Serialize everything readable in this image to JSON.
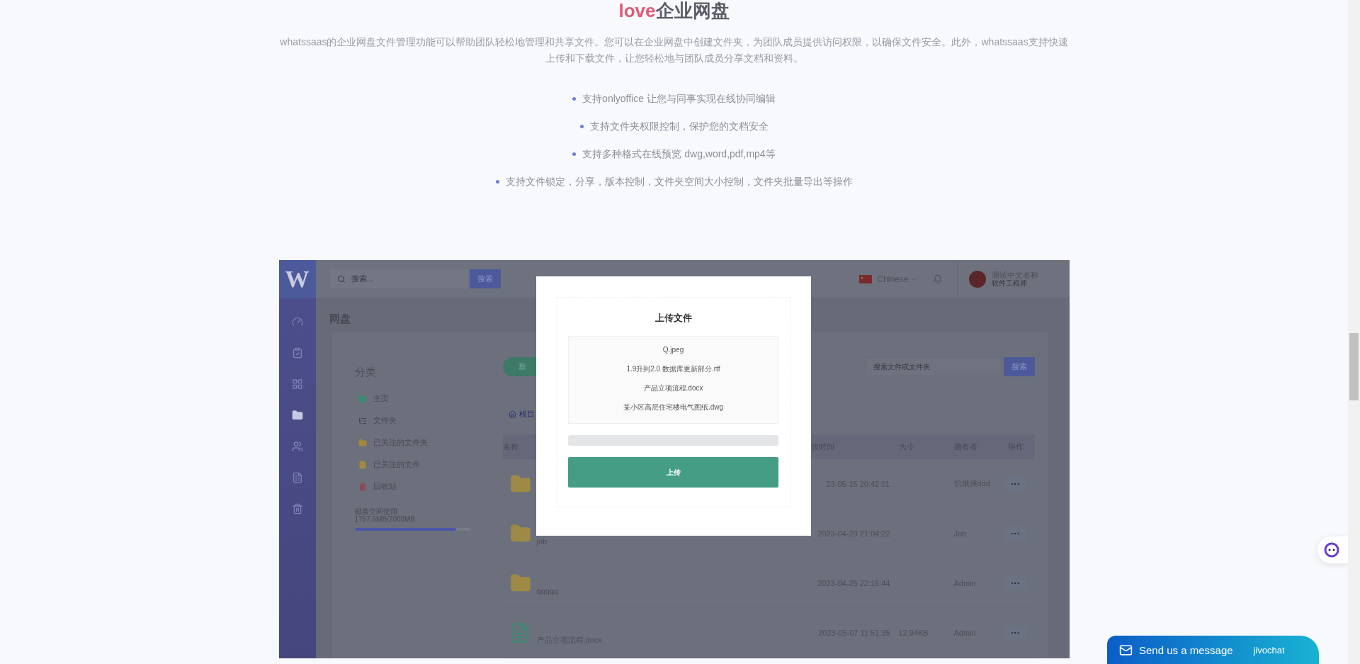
{
  "heading": {
    "accent": "love",
    "rest": "企业网盘"
  },
  "intro": "whatssaas的企业网盘文件管理功能可以帮助团队轻松地管理和共享文件。您可以在企业网盘中创建文件夹，为团队成员提供访问权限，以确保文件安全。此外，whatssaas支持快速上传和下载文件，让您轻松地与团队成员分享文档和资料。",
  "features": [
    "支持onlyoffice 让您与同事实现在线协同编辑",
    "支持文件夹权限控制，保护您的文档安全",
    "支持多种格式在线预览 dwg,word,pdf,mp4等",
    "支持文件锁定，分享，版本控制，文件夹空间大小控制，文件夹批量导出等操作"
  ],
  "app": {
    "logo": "W",
    "sidebar": [
      {
        "kind": "dashboard",
        "selected": false
      },
      {
        "kind": "clipboard",
        "selected": false
      },
      {
        "kind": "grid",
        "selected": false
      },
      {
        "kind": "folder",
        "selected": true
      },
      {
        "kind": "users",
        "selected": false
      },
      {
        "kind": "document",
        "selected": false
      },
      {
        "kind": "trash",
        "selected": false
      }
    ],
    "search": {
      "placeholder": "搜索...",
      "button": "搜索"
    },
    "language": "Chinese",
    "user": {
      "name": "测试中文名称",
      "role": "软件工程师"
    },
    "page_title": "网盘",
    "categories": {
      "title": "分类",
      "items": [
        {
          "kind": "home",
          "label": "主页"
        },
        {
          "kind": "tree",
          "label": "文件夹"
        },
        {
          "kind": "starred-folder",
          "label": "已关注的文件夹"
        },
        {
          "kind": "starred-file",
          "label": "已关注的文件"
        },
        {
          "kind": "trash",
          "label": "回收站"
        }
      ]
    },
    "storage": {
      "label": "磁盘空间使用",
      "usage": "1757.6MB/2000MB",
      "level": 0.88
    },
    "new_button": "新",
    "breadcrumb": "根目",
    "file_search": {
      "placeholder": "搜索文件或文件夹",
      "button": "搜索"
    },
    "table": {
      "columns": [
        "名称",
        "改时间",
        "大小",
        "拥有者",
        "操作"
      ],
      "rows": [
        {
          "kind": "folder",
          "modified": "23-05-15 20:42:01",
          "owner": "饥饿侠ddd",
          "action": "···"
        },
        {
          "kind": "folder",
          "name": "job",
          "modified": "2023-04-29 21:04:22",
          "owner": "Job",
          "action": "···"
        },
        {
          "kind": "folder",
          "name": "qqqqq",
          "modified": "2023-04-25 22:15:44",
          "owner": "Admin",
          "action": "···"
        },
        {
          "kind": "word",
          "name": "产品立项流程.docx",
          "modified": "2023-05-07 11:51:35",
          "size": "12.94KB",
          "owner": "Admin",
          "action": "···"
        }
      ]
    },
    "modal": {
      "title": "上传文件",
      "files": [
        "Q.jpeg",
        "1.9升到2.0 数据库更新部分.rtf",
        "产品立项流程.docx",
        "某小区高层住宅楼电气图纸.dwg"
      ],
      "progress": {
        "level": 0
      },
      "button": "上传"
    }
  },
  "chat": {
    "label": "Send us a message",
    "brand": "jivochat"
  }
}
